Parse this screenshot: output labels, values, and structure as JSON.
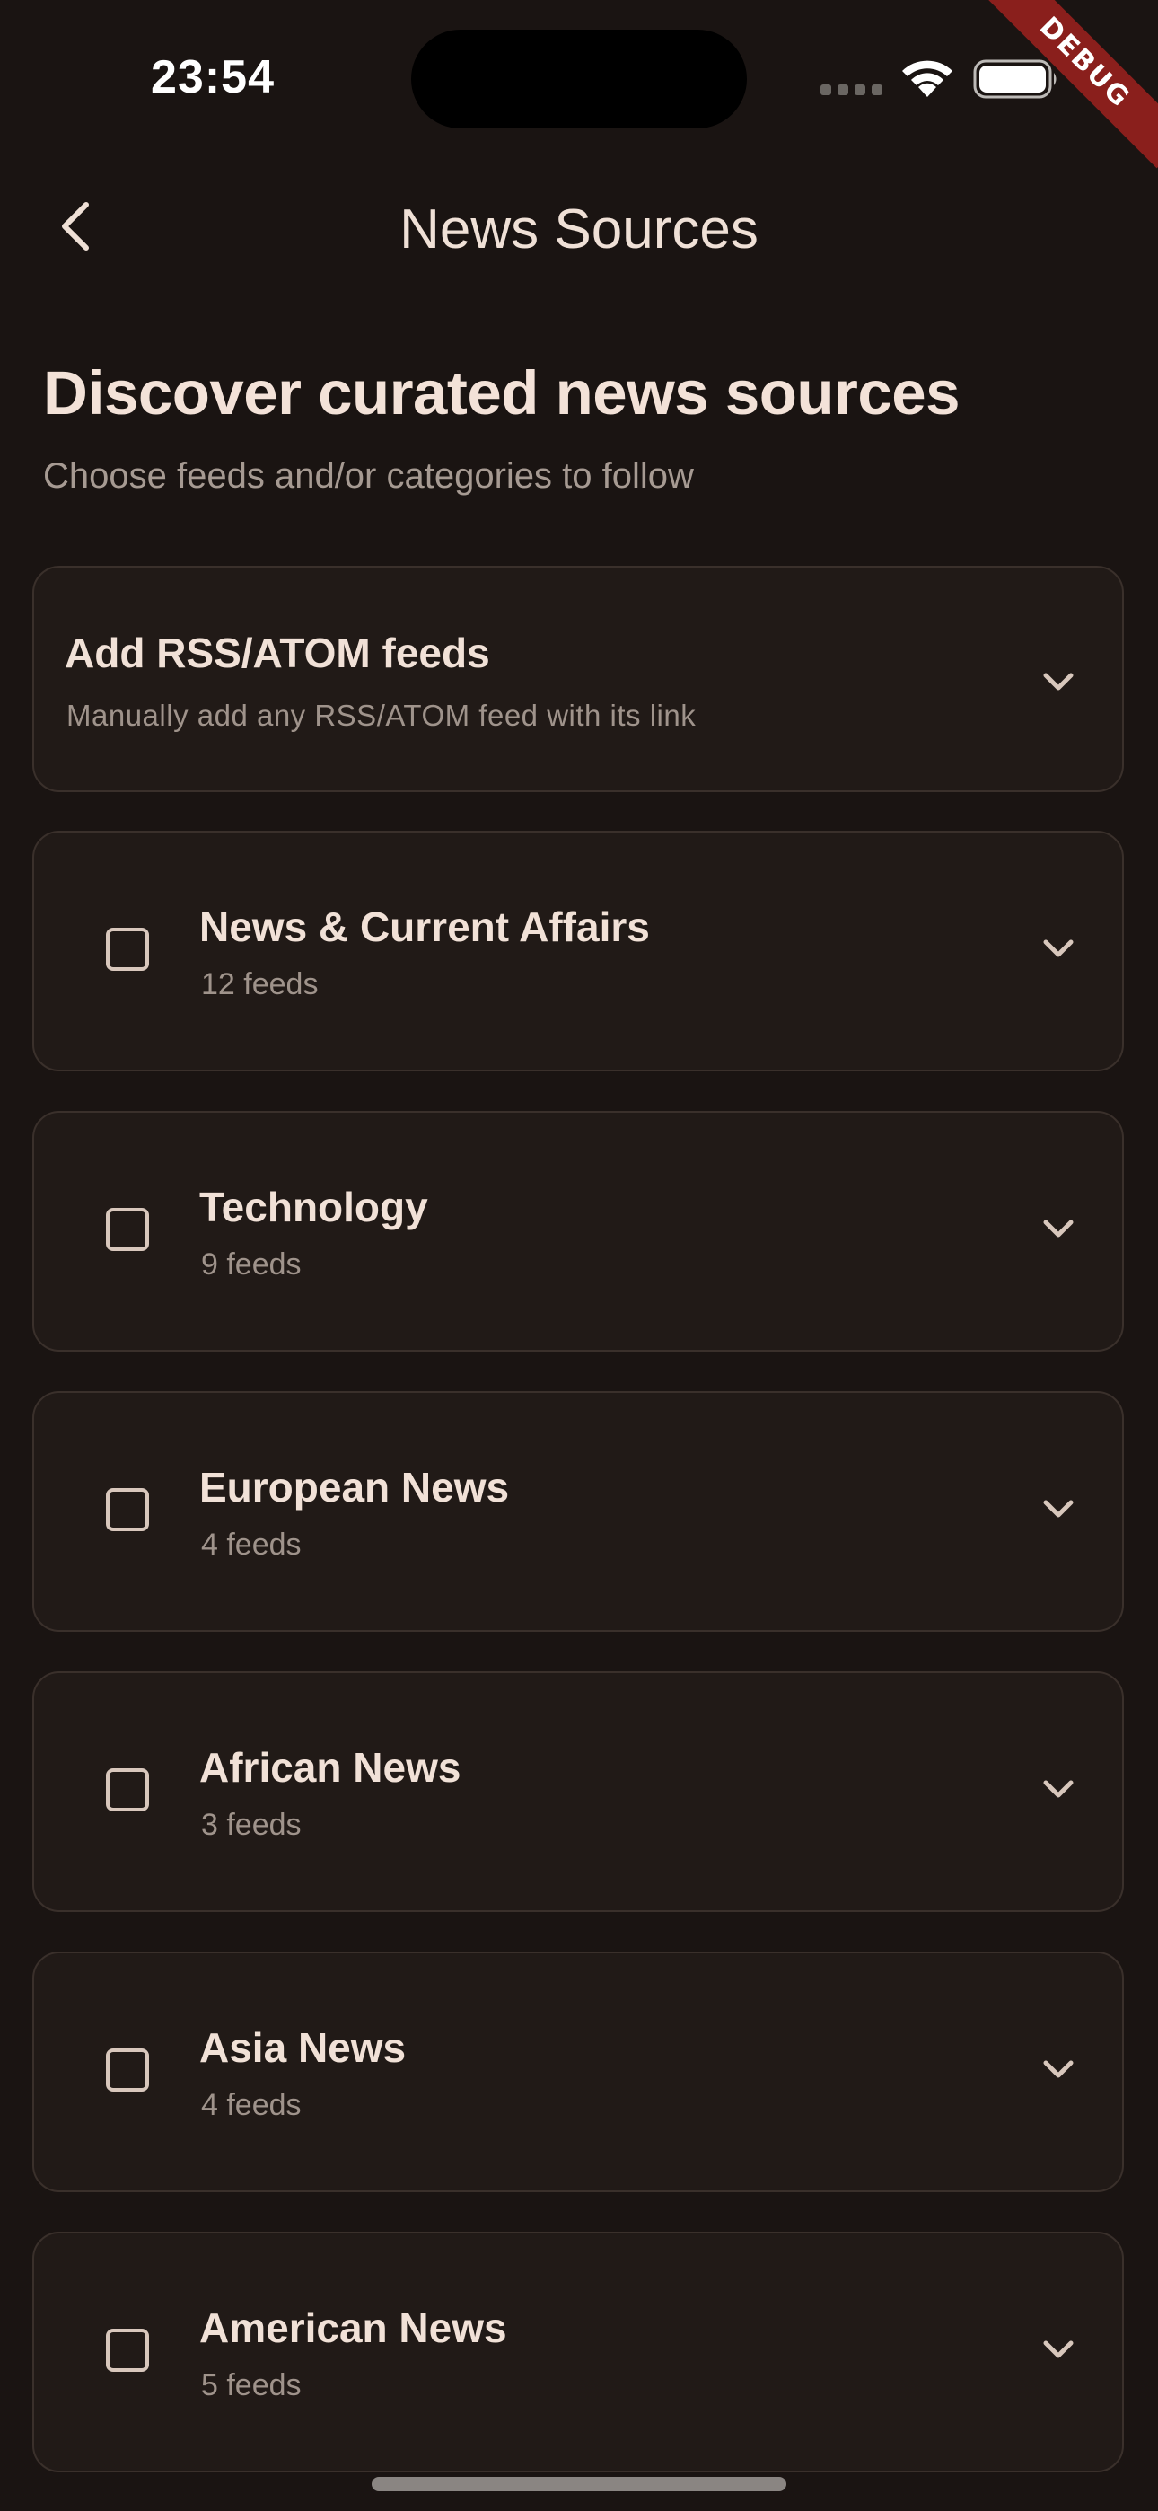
{
  "status_bar": {
    "time": "23:54",
    "debug_label": "DEBUG"
  },
  "app_bar": {
    "title": "News Sources",
    "back_icon": "chevron-left-icon"
  },
  "header": {
    "title": "Discover curated news sources",
    "subtitle": "Choose feeds and/or categories to follow"
  },
  "add_feed": {
    "title": "Add RSS/ATOM feeds",
    "subtitle": "Manually add any RSS/ATOM feed with its link"
  },
  "categories": [
    {
      "name": "News & Current Affairs",
      "count": "12 feeds",
      "checked": false
    },
    {
      "name": "Technology",
      "count": "9 feeds",
      "checked": false
    },
    {
      "name": "European News",
      "count": "4 feeds",
      "checked": false
    },
    {
      "name": "African News",
      "count": "3 feeds",
      "checked": false
    },
    {
      "name": "Asia News",
      "count": "4 feeds",
      "checked": false
    },
    {
      "name": "American News",
      "count": "5 feeds",
      "checked": false
    }
  ],
  "colors": {
    "background": "#1a1412",
    "card": "#211a17",
    "text_primary": "#f1e1d7",
    "text_secondary": "#9f938b",
    "debug_banner": "#8a1f1c"
  }
}
